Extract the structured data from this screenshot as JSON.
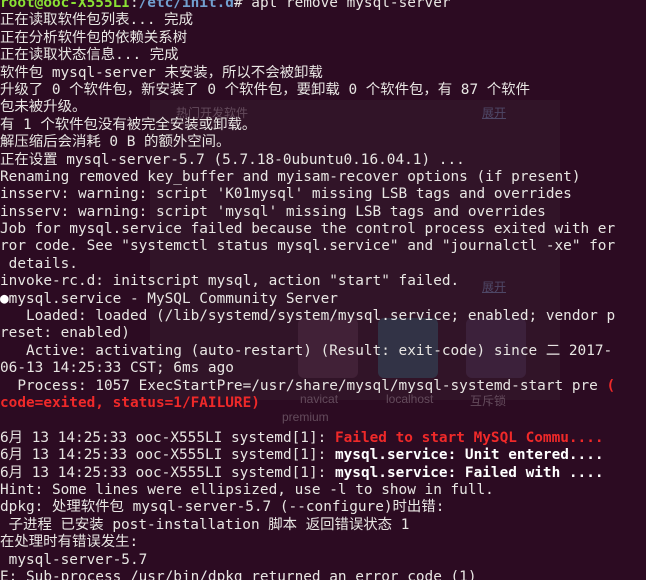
{
  "prompt": {
    "user": "root@ooc-X555LI",
    "sep": ":",
    "path": "/etc/init.d",
    "symbol": "# ",
    "command": "apt remove mysql-server"
  },
  "lines": [
    "正在读取软件包列表... 完成",
    "正在分析软件包的依赖关系树",
    "正在读取状态信息... 完成",
    "软件包 mysql-server 未安装，所以不会被卸载",
    "升级了 0 个软件包，新安装了 0 个软件包，要卸载 0 个软件包，有 87 个软件",
    "包未被升级。",
    "有 1 个软件包没有被完全安装或卸载。",
    "解压缩后会消耗 0 B 的额外空间。",
    "正在设置 mysql-server-5.7 (5.7.18-0ubuntu0.16.04.1) ...",
    "Renaming removed key_buffer and myisam-recover options (if present)",
    "insserv: warning: script 'K01mysql' missing LSB tags and overrides",
    "insserv: warning: script 'mysql' missing LSB tags and overrides",
    "Job for mysql.service failed because the control process exited with er",
    "ror code. See \"systemctl status mysql.service\" and \"journalctl -xe\" for",
    " details.",
    "invoke-rc.d: initscript mysql, action \"start\" failed."
  ],
  "service": {
    "bullet": "●",
    "title": "mysql.service - MySQL Community Server",
    "loaded_1": "   Loaded: loaded (/lib/systemd/system/mysql.service; enabled; vendor p",
    "loaded_2": "reset: enabled)",
    "active_1": "   Active: activating (auto-restart) (Result: exit-code) since 二 2017-",
    "active_2": "06-13 14:25:33 CST; 6ms ago",
    "process_1": "  Process: 1057 ExecStartPre=/usr/share/mysql/mysql-systemd-start pre ",
    "process_1_red": "(",
    "process_2_red": "code=exited, status=1/FAILURE)"
  },
  "journal": [
    {
      "prefix": "6月 13 14:25:33 ooc-X555LI systemd[1]: ",
      "msg": "Failed to start MySQL Commu....",
      "style": "red"
    },
    {
      "prefix": "6月 13 14:25:33 ooc-X555LI systemd[1]: ",
      "msg": "mysql.service: Unit entered....",
      "style": "bold"
    },
    {
      "prefix": "6月 13 14:25:33 ooc-X555LI systemd[1]: ",
      "msg": "mysql.service: Failed with ....",
      "style": "bold"
    }
  ],
  "tail": [
    "Hint: Some lines were ellipsized, use -l to show in full.",
    "dpkg: 处理软件包 mysql-server-5.7 (--configure)时出错:",
    " 子进程 已安装 post-installation 脚本 返回错误状态 1",
    "在处理时有错误发生:",
    " mysql-server-5.7",
    "E: Sub-process /usr/bin/dpkg returned an error code (1)"
  ],
  "background": {
    "heading": "热门开发软件",
    "expand_1": "展开",
    "expand_2": "展开",
    "labels": [
      "navicat",
      "localhost",
      "互斥锁",
      "premium"
    ]
  },
  "colors": {
    "background": "#2c0b22",
    "text": "#e8e6e3",
    "user": "#8ae234",
    "path": "#729fcf",
    "error": "#ef2929"
  }
}
